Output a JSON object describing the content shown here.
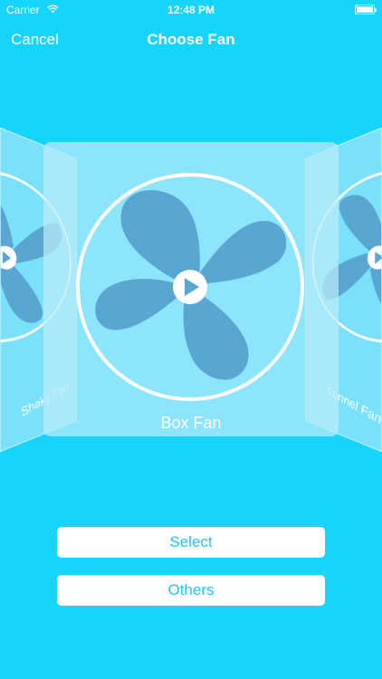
{
  "status_bar": {
    "carrier": "Carrier",
    "time": "12:48 PM"
  },
  "nav": {
    "cancel": "Cancel",
    "title": "Choose Fan"
  },
  "carousel": {
    "left_card": {
      "label": "Shaky Fan"
    },
    "main_card": {
      "label": "Box Fan"
    },
    "right_card": {
      "label": "Funnel Fan"
    }
  },
  "buttons": {
    "select": "Select",
    "others": "Others"
  },
  "colors": {
    "background": "#17d4fb",
    "blade": "#5aa6d3",
    "button_text": "#1cc8f2"
  }
}
